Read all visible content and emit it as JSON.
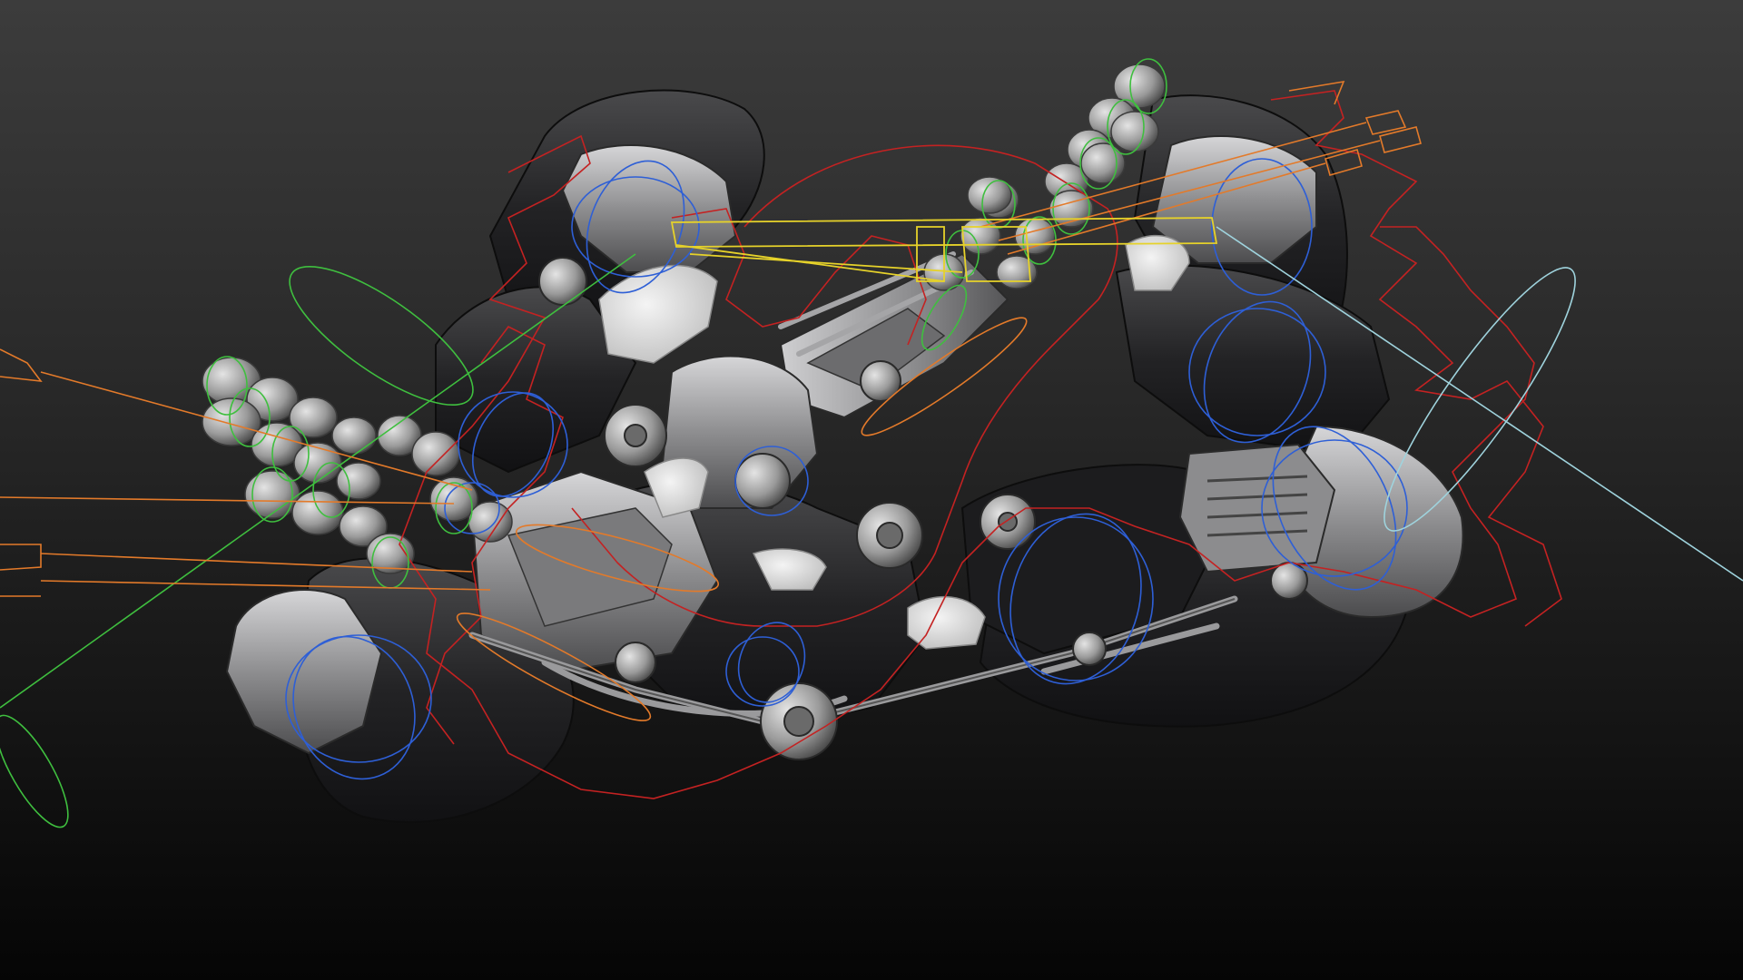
{
  "viewport": {
    "label": "",
    "background_top": "#3c3c3c",
    "background_bottom": "#050505"
  },
  "scene": {
    "model": "mechanical-exoskeleton-arms",
    "mesh_dark": "#1f1f21",
    "mesh_mid": "#5a5a5c",
    "mesh_light": "#a8a8aa",
    "mesh_highlight": "#d8d8d8",
    "cloth": "#e6e6e6"
  },
  "rig_controls": {
    "fk_circle_color": "#2e5fd6",
    "finger_control_color": "#3fbf3f",
    "ik_curve_color": "#c42222",
    "pole_line_color": "#e37a2a",
    "selected_color": "#e6d22a",
    "aux_curve_color": "#9fd3dd"
  }
}
